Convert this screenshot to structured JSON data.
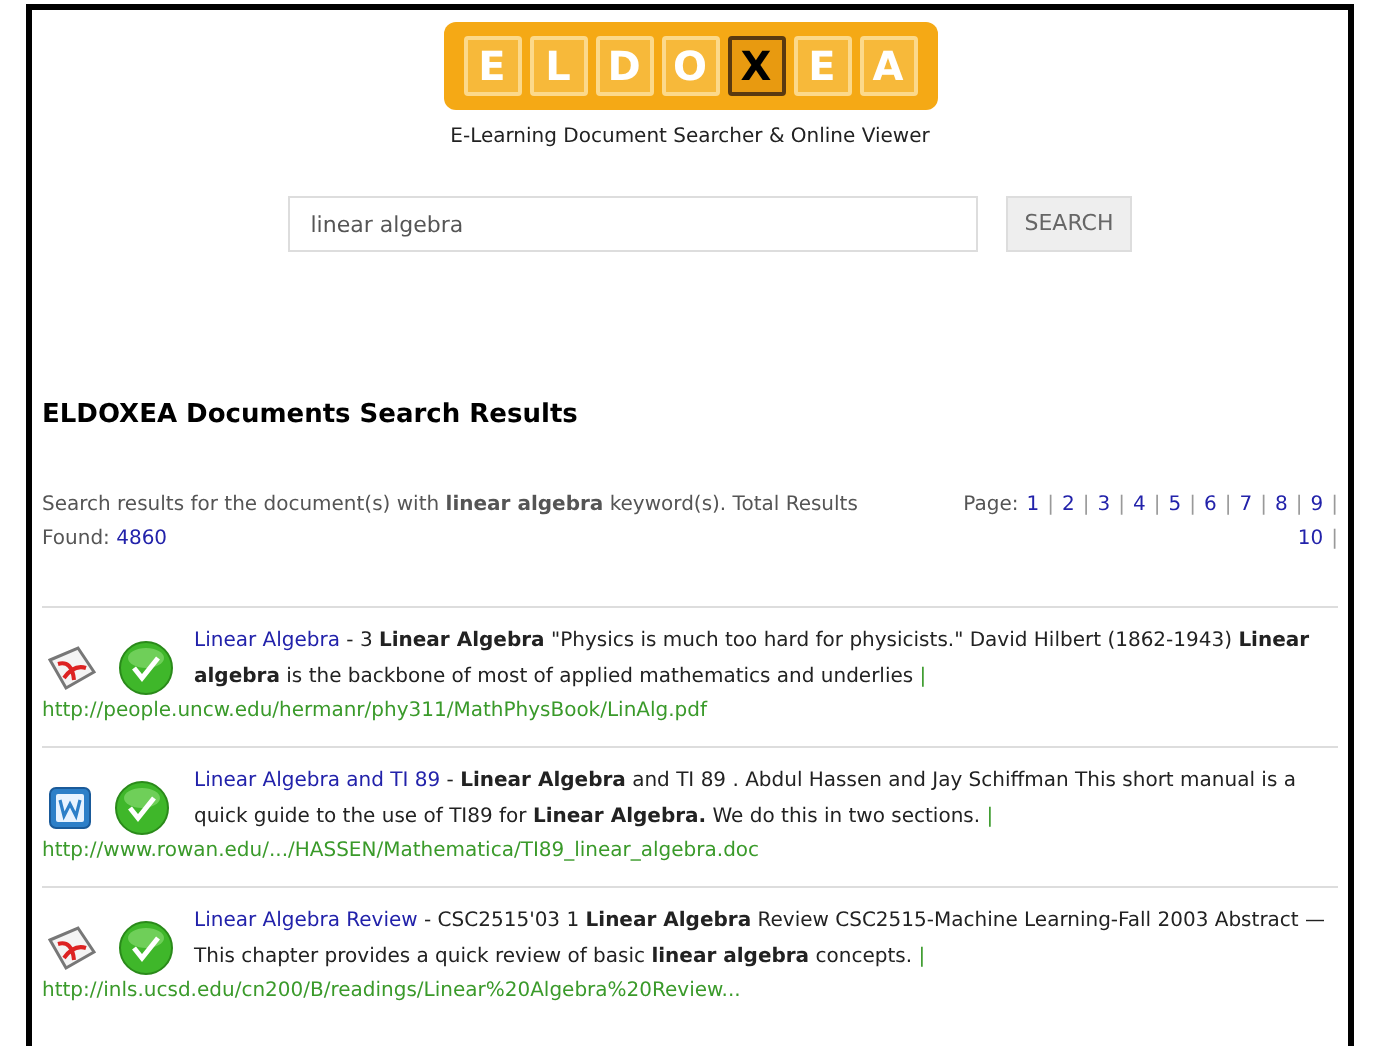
{
  "logo": {
    "tiles": [
      {
        "letter": "E",
        "highlighted": false
      },
      {
        "letter": "L",
        "highlighted": false
      },
      {
        "letter": "D",
        "highlighted": false
      },
      {
        "letter": "O",
        "highlighted": false
      },
      {
        "letter": "X",
        "highlighted": true
      },
      {
        "letter": "E",
        "highlighted": false
      },
      {
        "letter": "A",
        "highlighted": false
      }
    ]
  },
  "tagline": "E-Learning Document Searcher & Online Viewer",
  "search": {
    "value": "linear algebra",
    "button": "SEARCH"
  },
  "heading": "ELDOXEA Documents Search Results",
  "summary": {
    "text": "Search results for the document(s) with **linear algebra** keyword(s). Total Results Found:",
    "count": "4860"
  },
  "pagination": [
    {
      "kind": "label",
      "text": "Page:"
    },
    {
      "kind": "link",
      "text": "1"
    },
    {
      "kind": "sep",
      "text": "|"
    },
    {
      "kind": "link",
      "text": "2"
    },
    {
      "kind": "sep",
      "text": "|"
    },
    {
      "kind": "link",
      "text": "3"
    },
    {
      "kind": "sep",
      "text": "|"
    },
    {
      "kind": "link",
      "text": "4"
    },
    {
      "kind": "sep",
      "text": "|"
    },
    {
      "kind": "link",
      "text": "5"
    },
    {
      "kind": "sep",
      "text": "|"
    },
    {
      "kind": "link",
      "text": "6"
    },
    {
      "kind": "sep",
      "text": "|"
    },
    {
      "kind": "link",
      "text": "7"
    },
    {
      "kind": "sep",
      "text": "|"
    },
    {
      "kind": "link",
      "text": "8"
    },
    {
      "kind": "sep",
      "text": "|"
    },
    {
      "kind": "link",
      "text": "9"
    },
    {
      "kind": "sep",
      "text": "|"
    },
    {
      "kind": "link",
      "text": "10"
    },
    {
      "kind": "sep",
      "text": "|"
    }
  ],
  "results": [
    {
      "kind": "pdf",
      "title": "Linear Algebra",
      "snippet": "- 3 **Linear Algebra** \"Physics is much too hard for physicists.\" David Hilbert (1862-1943) **Linear algebra** is the backbone of most of applied mathematics and underlies",
      "sep": "|",
      "url": "http://people.uncw.edu/hermanr/phy311/MathPhysBook/LinAlg.pdf"
    },
    {
      "kind": "doc",
      "title": "Linear Algebra and TI 89",
      "snippet": "- **Linear Algebra** and TI 89 . Abdul Hassen and Jay Schiffman This short manual is a quick guide to the use of TI89 for **Linear Algebra.** We do this in two sections.",
      "sep": "|",
      "url": "http://www.rowan.edu/.../HASSEN/Mathematica/TI89_linear_algebra.doc"
    },
    {
      "kind": "pdf",
      "title": "Linear Algebra Review",
      "snippet": "- CSC2515'03 1 **Linear Algebra** Review CSC2515-Machine Learning-Fall 2003 Abstract —This chapter provides a quick review of basic **linear algebra** concepts.",
      "sep": "|",
      "url": "http://inls.ucsd.edu/cn200/B/readings/Linear%20Algebra%20Review..."
    }
  ]
}
